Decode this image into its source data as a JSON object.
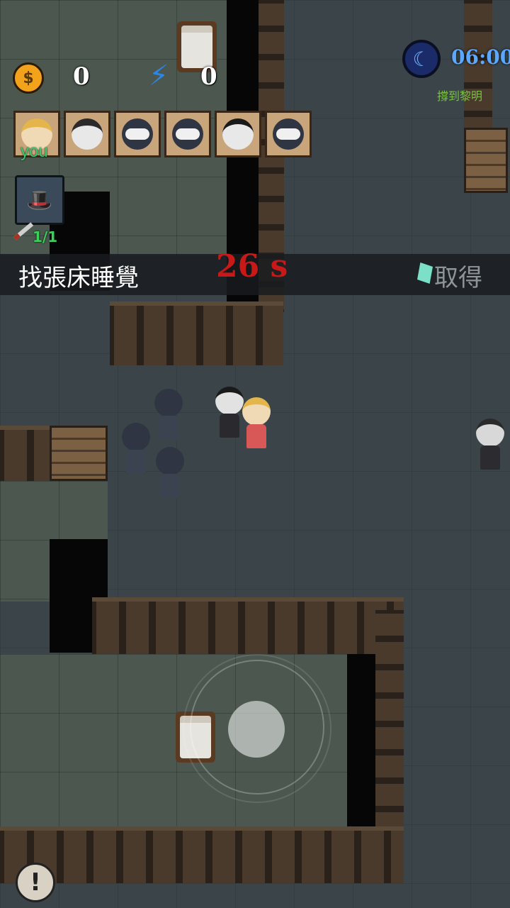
{
  "hud": {
    "coins": "0",
    "energy": "0",
    "clock": "06:00",
    "objective_hint": "撐到黎明",
    "coin_symbol": "$",
    "bolt_symbol": "⚡"
  },
  "players": [
    {
      "name": "you-portrait",
      "label": "you"
    },
    {
      "name": "gentleman-portrait",
      "label": ""
    },
    {
      "name": "hooded-portrait-1",
      "label": ""
    },
    {
      "name": "hooded-portrait-2",
      "label": ""
    },
    {
      "name": "pale-man-portrait",
      "label": ""
    },
    {
      "name": "hooded-portrait-3",
      "label": ""
    }
  ],
  "killer": {
    "count": "1/1"
  },
  "task": {
    "label": "找張床睡覺",
    "timer": "26 s",
    "obtain_label": "取得"
  },
  "alert_symbol": "!",
  "colors": {
    "coin": "#f3a21c",
    "energy": "#2b86e6",
    "clock": "#5aa8ff",
    "timer": "#c81818",
    "you_label": "#39c96f",
    "kill_count": "#3ad05a"
  }
}
